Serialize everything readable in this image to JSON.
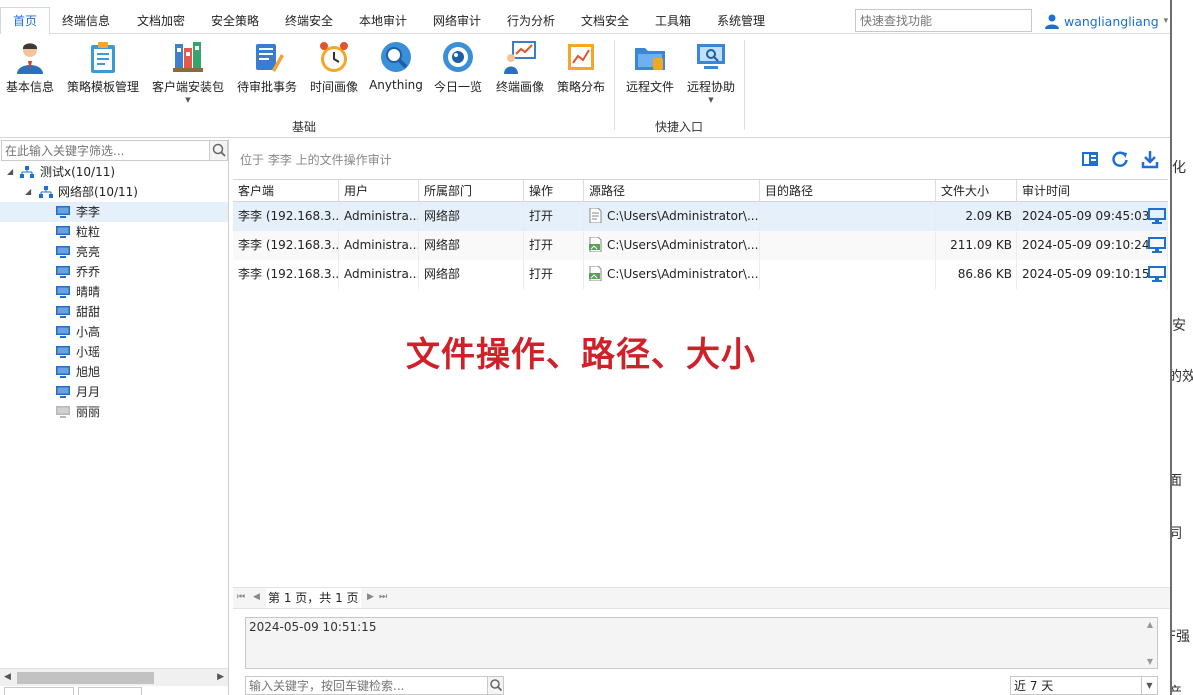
{
  "menu": {
    "tabs": [
      "首页",
      "终端信息",
      "文档加密",
      "安全策略",
      "终端安全",
      "本地审计",
      "网络审计",
      "行为分析",
      "文档安全",
      "工具箱",
      "系统管理"
    ],
    "active": "首页",
    "search_placeholder": "快速查找功能",
    "user": "wangliangliang"
  },
  "ribbon": {
    "buttons": [
      "基本信息",
      "策略模板管理",
      "客户端安装包",
      "待审批事务",
      "时间画像",
      "Anything",
      "今日一览",
      "终端画像",
      "策略分布",
      "远程文件",
      "远程协助"
    ],
    "groups": [
      "基础",
      "快捷入口"
    ]
  },
  "tree": {
    "filter_placeholder": "在此输入关键字筛选...",
    "root": "测试x(10/11)",
    "group": "网络部(10/11)",
    "users": [
      "李李",
      "粒粒",
      "亮亮",
      "乔乔",
      "晴晴",
      "甜甜",
      "小高",
      "小瑶",
      "旭旭",
      "月月",
      "丽丽"
    ],
    "selected": "李李",
    "offline": [
      "丽丽"
    ]
  },
  "main": {
    "location": "位于 李李 上的文件操作审计",
    "columns": [
      "客户端",
      "用户",
      "所属部门",
      "操作",
      "源路径",
      "目的路径",
      "文件大小",
      "审计时间"
    ],
    "rows": [
      {
        "client": "李李 (192.168.3...",
        "user": "Administra...",
        "dept": "网络部",
        "op": "打开",
        "src": "C:\\Users\\Administrator\\...",
        "dst": "",
        "size": "2.09 KB",
        "time": "2024-05-09 09:45:03",
        "file_icon": "text-file-icon"
      },
      {
        "client": "李李 (192.168.3...",
        "user": "Administra...",
        "dept": "网络部",
        "op": "打开",
        "src": "C:\\Users\\Administrator\\...",
        "dst": "",
        "size": "211.09 KB",
        "time": "2024-05-09 09:10:24",
        "file_icon": "png-file-icon"
      },
      {
        "client": "李李 (192.168.3...",
        "user": "Administra...",
        "dept": "网络部",
        "op": "打开",
        "src": "C:\\Users\\Administrator\\...",
        "dst": "",
        "size": "86.86 KB",
        "time": "2024-05-09 09:10:15",
        "file_icon": "png-file-icon"
      }
    ],
    "annotation": "文件操作、路径、大小",
    "pager": "第 1 页，共 1 页",
    "log_text": "2024-05-09 10:51:15",
    "keyword_placeholder": "输入关键字，按回车键检索...",
    "range": "近 7 天"
  },
  "background_window": {
    "fragments": [
      "化",
      "安",
      "的效",
      "面",
      "同",
      "F强",
      "产"
    ]
  },
  "colors": {
    "accent": "#1e6fd0",
    "selected_row": "#e5f0fb",
    "annotation": "#d0212a"
  }
}
